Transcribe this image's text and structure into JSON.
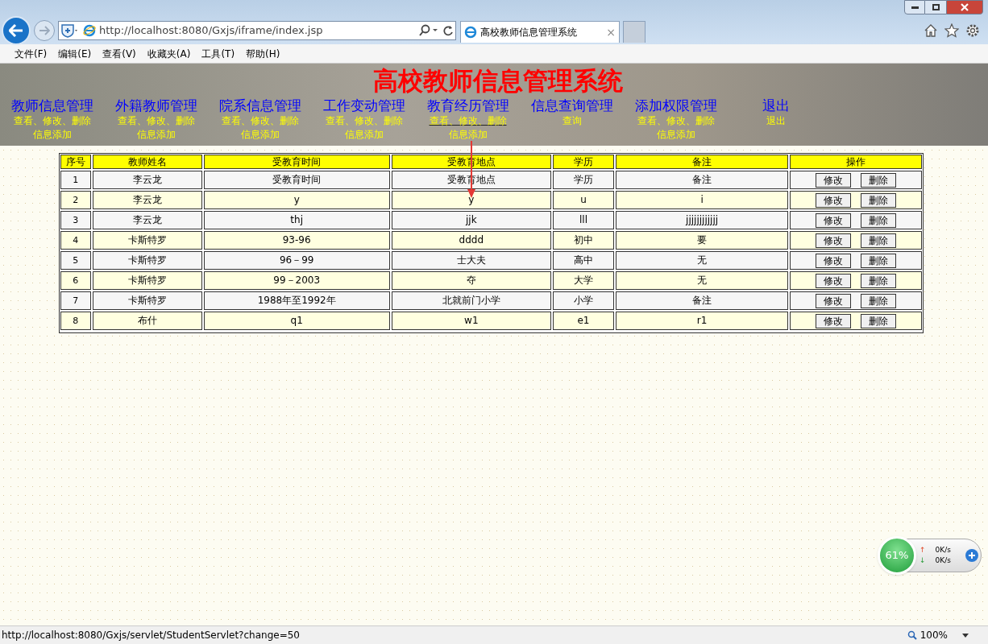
{
  "browser": {
    "address": "http://localhost:8080/Gxjs/iframe/index.jsp",
    "tab_title": "高校教师信息管理系统",
    "tab_close": "×",
    "menu": [
      "文件(F)",
      "编辑(E)",
      "查看(V)",
      "收藏夹(A)",
      "工具(T)",
      "帮助(H)"
    ],
    "status_url": "http://localhost:8080/Gxjs/servlet/StudentServlet?change=50",
    "zoom": "100%"
  },
  "page": {
    "title": "高校教师信息管理系统",
    "nav": [
      {
        "title": "教师信息管理",
        "links": [
          {
            "text": "查看、修改、删除",
            "hovered": false
          },
          {
            "text": "信息添加",
            "hovered": false
          }
        ]
      },
      {
        "title": "外籍教师管理",
        "links": [
          {
            "text": "查看、修改、删除",
            "hovered": false
          },
          {
            "text": "信息添加",
            "hovered": false
          }
        ]
      },
      {
        "title": "院系信息管理",
        "links": [
          {
            "text": "查看、修改、删除",
            "hovered": false
          },
          {
            "text": "信息添加",
            "hovered": false
          }
        ]
      },
      {
        "title": "工作变动管理",
        "links": [
          {
            "text": "查看、修改、删除",
            "hovered": false
          },
          {
            "text": "信息添加",
            "hovered": false
          }
        ]
      },
      {
        "title": "教育经历管理",
        "links": [
          {
            "text": "查看、修改、删除",
            "hovered": true
          },
          {
            "text": "信息添加",
            "hovered": false
          }
        ]
      },
      {
        "title": "信息查询管理",
        "links": [
          {
            "text": "查询",
            "hovered": false
          }
        ]
      },
      {
        "title": "添加权限管理",
        "links": [
          {
            "text": "查看、修改、删除",
            "hovered": false
          },
          {
            "text": "信息添加",
            "hovered": false
          }
        ]
      },
      {
        "title": "退出",
        "links": [
          {
            "text": "退出",
            "hovered": false
          }
        ]
      }
    ],
    "table": {
      "columns": [
        "序号",
        "教师姓名",
        "受教育时间",
        "受教育地点",
        "学历",
        "备注",
        "操作"
      ],
      "rows": [
        {
          "cells": [
            "1",
            "李云龙",
            "受教育时间",
            "受教育地点",
            "学历",
            "备注"
          ],
          "actions": [
            "修改",
            "删除"
          ]
        },
        {
          "cells": [
            "2",
            "李云龙",
            "y",
            "y",
            "u",
            "i"
          ],
          "actions": [
            "修改",
            "删除"
          ]
        },
        {
          "cells": [
            "3",
            "李云龙",
            "thj",
            "jjk",
            "lll",
            "jjjjjjjjjjjj"
          ],
          "actions": [
            "修改",
            "删除"
          ]
        },
        {
          "cells": [
            "4",
            "卡斯特罗",
            "93-96",
            "dddd",
            "初中",
            "要"
          ],
          "actions": [
            "修改",
            "删除"
          ]
        },
        {
          "cells": [
            "5",
            "卡斯特罗",
            "96－99",
            "士大夫",
            "高中",
            "无"
          ],
          "actions": [
            "修改",
            "删除"
          ]
        },
        {
          "cells": [
            "6",
            "卡斯特罗",
            "99－2003",
            "夺",
            "大学",
            "无"
          ],
          "actions": [
            "修改",
            "删除"
          ]
        },
        {
          "cells": [
            "7",
            "卡斯特罗",
            "1988年至1992年",
            "北就前门小学",
            "小学",
            "备注"
          ],
          "actions": [
            "修改",
            "删除"
          ]
        },
        {
          "cells": [
            "8",
            "布什",
            "q1",
            "w1",
            "e1",
            "r1"
          ],
          "actions": [
            "修改",
            "删除"
          ]
        }
      ]
    }
  },
  "widget": {
    "percent": "61%",
    "upload_arrow": "↑",
    "upload": "0K/s",
    "download_arrow": "↓",
    "download": "0K/s"
  }
}
